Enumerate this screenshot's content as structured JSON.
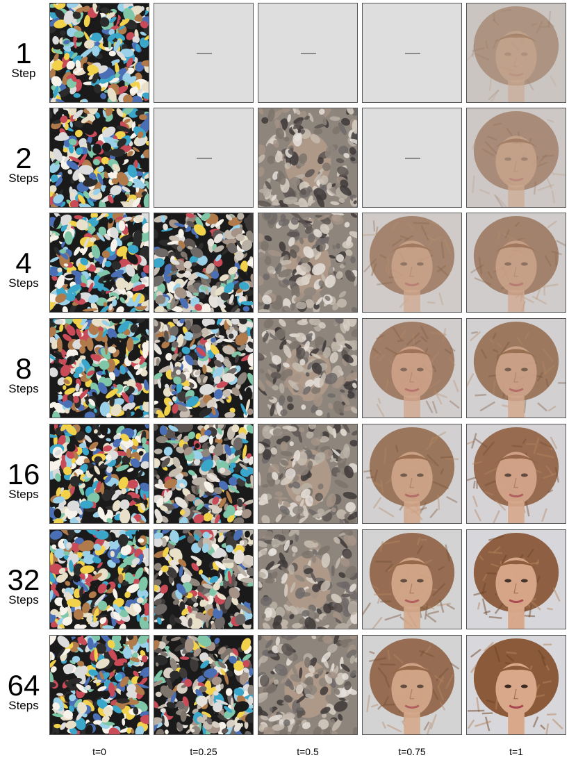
{
  "rows": [
    {
      "number": "1",
      "unit": "Step",
      "cells": [
        "noise",
        "empty",
        "empty",
        "empty",
        "face"
      ]
    },
    {
      "number": "2",
      "unit": "Steps",
      "cells": [
        "noise",
        "empty",
        "noise-face",
        "empty",
        "face"
      ]
    },
    {
      "number": "4",
      "unit": "Steps",
      "cells": [
        "noise",
        "noise",
        "noise-face",
        "face",
        "face"
      ]
    },
    {
      "number": "8",
      "unit": "Steps",
      "cells": [
        "noise",
        "noise",
        "noise-face",
        "face",
        "face"
      ]
    },
    {
      "number": "16",
      "unit": "Steps",
      "cells": [
        "noise",
        "noise",
        "noise-face",
        "face",
        "face"
      ]
    },
    {
      "number": "32",
      "unit": "Steps",
      "cells": [
        "noise",
        "noise",
        "noise-face",
        "face",
        "face"
      ]
    },
    {
      "number": "64",
      "unit": "Steps",
      "cells": [
        "noise",
        "noise",
        "noise-face",
        "face",
        "face"
      ]
    }
  ],
  "columns": [
    "t=0",
    "t=0.25",
    "t=0.5",
    "t=0.75",
    "t=1"
  ],
  "colors": {
    "placeholder_bg": "#dedede",
    "dash": "#8a8a8a",
    "hair": "#8b5a3a",
    "skin": "#d9a88a",
    "background": "#d8d8dc"
  }
}
